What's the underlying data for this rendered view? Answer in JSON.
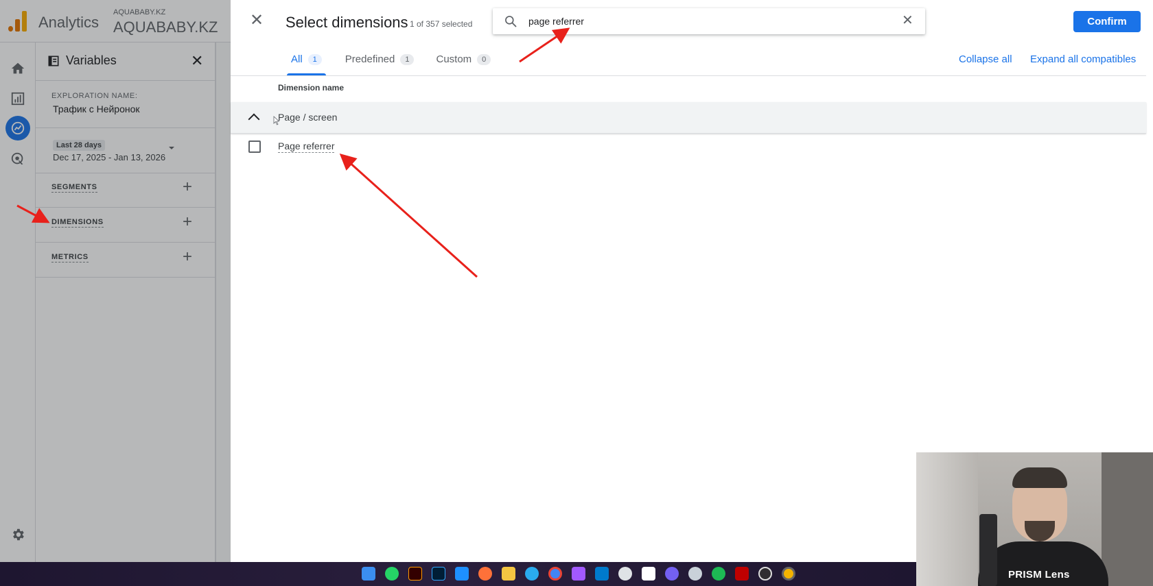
{
  "app": {
    "name": "Analytics",
    "account_small": "AQUABABY.KZ",
    "account_big": "AQUABABY.KZ"
  },
  "nav_rail": {
    "items": [
      "home-icon",
      "reports-icon",
      "explore-icon",
      "advertising-icon"
    ],
    "settings_icon": "gear-icon",
    "accent": "#1a73e8"
  },
  "variables": {
    "title": "Variables",
    "exploration_label": "EXPLORATION NAME:",
    "exploration_name": "Трафик с Нейронок",
    "date_chip": "Last 28 days",
    "date_range": "Dec 17, 2025 - Jan 13, 2026",
    "sections": [
      "SEGMENTS",
      "DIMENSIONS",
      "METRICS"
    ],
    "add_symbol": "+"
  },
  "dialog": {
    "title": "Select dimensions",
    "count": "1 of 357 selected",
    "search_value": "page referrer",
    "confirm_label": "Confirm",
    "tabs": [
      {
        "label": "All",
        "count": "1"
      },
      {
        "label": "Predefined",
        "count": "1"
      },
      {
        "label": "Custom",
        "count": "0"
      }
    ],
    "collapse_all": "Collapse all",
    "expand_all": "Expand all compatibles",
    "column_header": "Dimension name",
    "group_label": "Page / screen",
    "items": [
      {
        "label": "Page referrer",
        "checked": false
      }
    ]
  },
  "webcam": {
    "overlay_text": "PRISM Lens"
  },
  "taskbar": {
    "icons": [
      "windows-icon",
      "whatsapp-icon",
      "illustrator-icon",
      "photoshop-icon",
      "cloud-icon",
      "firefox-icon",
      "folder-icon",
      "telegram-icon",
      "chrome-icon",
      "figma-icon",
      "vscode-icon",
      "chatgpt-icon",
      "notion-icon",
      "viber-icon",
      "github-icon",
      "spotify-icon",
      "filezilla-icon",
      "obs-icon",
      "chrome-canary-icon"
    ]
  },
  "colors": {
    "primary": "#1a73e8",
    "annotation_arrow": "#e8211b"
  }
}
